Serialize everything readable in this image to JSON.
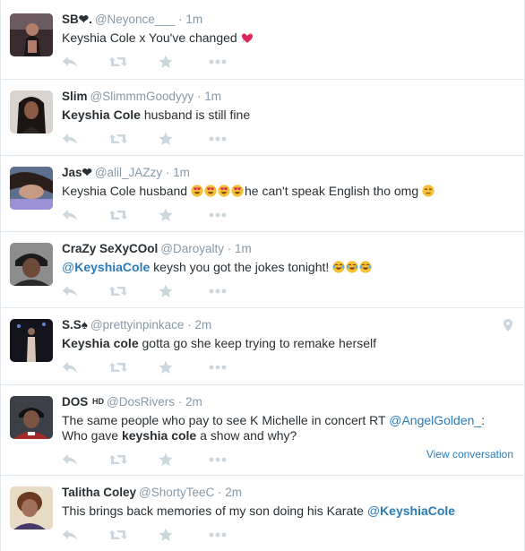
{
  "colors": {
    "link": "#2b7bb9",
    "meta": "#8899a6",
    "icon": "#ccd6dd",
    "divider": "#e1e8ed"
  },
  "icons": [
    "reply-icon",
    "retweet-icon",
    "favorite-icon",
    "more-icon",
    "location-pin-icon"
  ],
  "tweets": [
    {
      "fullname": "SB❤.",
      "handle": "@Neyonce___",
      "time": "1m",
      "text_plain": "Keyshia Cole x You've changed",
      "emoji": [
        "sparkling-heart-emoji"
      ]
    },
    {
      "fullname": "Slim",
      "handle": "@SlimmmGoodyyy",
      "time": "1m",
      "bold": "Keyshia Cole",
      "text_rest": "husband is still fine"
    },
    {
      "fullname": "Jas❤",
      "handle": "@alil_JAZzy",
      "time": "1m",
      "text_a": "Keyshia Cole husband",
      "text_b": "he can't speak English tho omg",
      "emoji": [
        "heart-eyes-emoji",
        "heart-eyes-emoji",
        "heart-eyes-emoji",
        "heart-eyes-emoji",
        "unamused-emoji"
      ]
    },
    {
      "fullname": "CraZy SeXyCOol",
      "handle": "@Daroyalty",
      "time": "1m",
      "at": "@",
      "mention": "KeyshiaCole",
      "text_rest": "keysh you got the jokes tonight!",
      "emoji": [
        "tears-of-joy-emoji",
        "tears-of-joy-emoji",
        "tears-of-joy-emoji"
      ]
    },
    {
      "fullname": "S.S♠",
      "handle": "@prettyinpinkace",
      "time": "2m",
      "bold": "Keyshia cole",
      "text_rest": "gotta go she keep trying to remake herself"
    },
    {
      "fullname": "DOS",
      "badge": "HD",
      "handle": "@DosRivers",
      "time": "2m",
      "line1": "The same people who pay to see K Michelle in concert RT",
      "mention_at": "@",
      "mention": "AngelGolden_",
      "colon": ":",
      "line2_a": "Who gave",
      "bold": "keyshia cole",
      "line2_b": "a show and why?",
      "view_conversation": "View conversation"
    },
    {
      "fullname": "Talitha Coley",
      "handle": "@ShortyTeeC",
      "time": "2m",
      "text_plain": "This brings back memories of my son doing his Karate",
      "at": "@",
      "mention": "KeyshiaCole"
    }
  ]
}
